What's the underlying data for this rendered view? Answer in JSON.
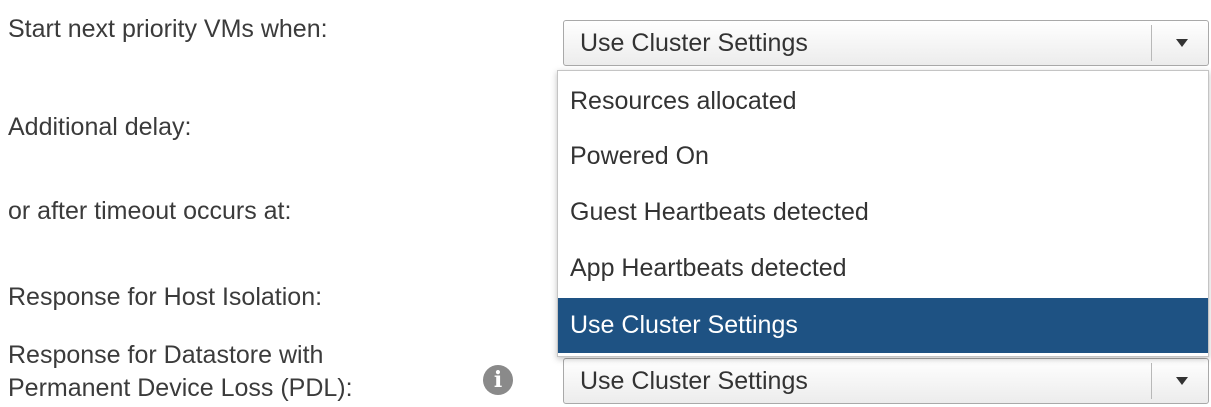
{
  "labels": {
    "start_next": "Start next priority VMs when:",
    "additional_delay": "Additional delay:",
    "timeout": "or after timeout occurs at:",
    "host_isolation": "Response for Host Isolation:",
    "pdl_line1": "Response for Datastore with",
    "pdl_line2": "Permanent Device Loss (PDL):"
  },
  "start_select": {
    "value": "Use Cluster Settings",
    "options": [
      "Resources allocated",
      "Powered On",
      "Guest Heartbeats detected",
      "App Heartbeats detected",
      "Use Cluster Settings"
    ],
    "selected_index": 4
  },
  "pdl_select": {
    "value": "Use Cluster Settings"
  },
  "icons": {
    "info": "info-icon",
    "dropdown_arrow": "chevron-down-icon"
  },
  "colors": {
    "selected_option_bg": "#1e5283",
    "label_text": "#3b3b3b"
  }
}
